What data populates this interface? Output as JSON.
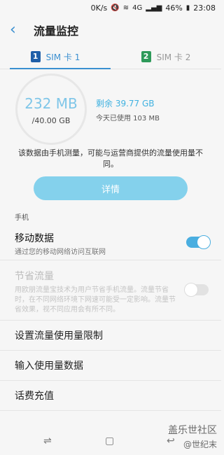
{
  "status_bar": {
    "speed": "0K/s",
    "network": "4G",
    "battery": "46%",
    "time": "23:08"
  },
  "header": {
    "title": "流量监控"
  },
  "tabs": [
    {
      "num": "1",
      "label": "SIM 卡 1",
      "active": true
    },
    {
      "num": "2",
      "label": "SIM 卡 2",
      "active": false
    }
  ],
  "usage": {
    "used": "232 MB",
    "limit": "/40.00 GB",
    "remaining": "剩余 39.77 GB",
    "today": "今天已使用 103 MB"
  },
  "notice": "该数据由手机测量，可能与运营商提供的流量使用量不同。",
  "details_button": "详情",
  "section_phone": "手机",
  "mobile_data": {
    "title": "移动数据",
    "subtitle": "通过您的移动网络访问互联网",
    "enabled": true
  },
  "data_saver": {
    "title": "节省流量",
    "subtitle": "用欧朋流量宝技术为用户节省手机流量。流量节省时，在不同网络环境下网速可能受一定影响。流量节省效果，视不同应用会有所不同。",
    "enabled": false
  },
  "menu": {
    "set_limit": "设置流量使用量限制",
    "input_usage": "输入使用量数据",
    "recharge": "话费充值"
  },
  "watermark": {
    "line1": "盖乐世社区",
    "line2": "@世纪末"
  }
}
